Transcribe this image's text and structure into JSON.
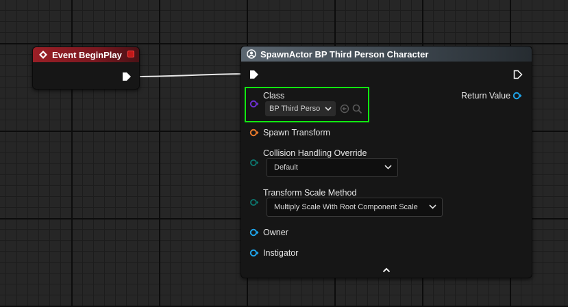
{
  "event_node": {
    "title": "Event BeginPlay",
    "icon": "diamond-event-icon",
    "accent_color": "#9a1f26"
  },
  "spawn_node": {
    "title": "SpawnActor BP Third Person Character",
    "icon": "spawn-actor-icon",
    "pins": {
      "class_label": "Class",
      "class_value": "BP Third Perso",
      "return_value_label": "Return Value",
      "spawn_transform_label": "Spawn Transform",
      "collision_label": "Collision Handling Override",
      "collision_value": "Default",
      "scale_method_label": "Transform Scale Method",
      "scale_method_value": "Multiply Scale With Root Component Scale",
      "owner_label": "Owner",
      "instigator_label": "Instigator"
    },
    "collapse_icon": "chevron-up-icon",
    "highlight_color": "#11e911"
  },
  "colors": {
    "exec": "#ffffff",
    "class_pin": "#6c2fcf",
    "transform_pin": "#e8792a",
    "enum_pin": "#0c7a72",
    "object_pin": "#1fa3e8"
  }
}
